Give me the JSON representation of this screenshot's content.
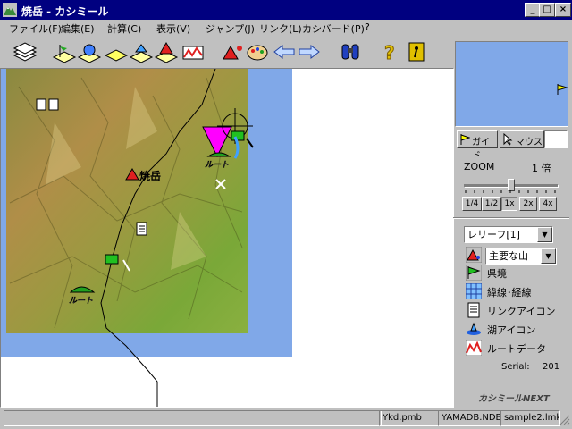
{
  "window": {
    "title": "焼岳 - カシミール"
  },
  "menu": [
    {
      "label": "ファイル(F)"
    },
    {
      "label": "編集(E)"
    },
    {
      "label": "計算(C)"
    },
    {
      "label": "表示(V)"
    },
    {
      "label": "ジャンプ(J)"
    },
    {
      "label": "リンク(L)"
    },
    {
      "label": "カシバード(P)"
    },
    {
      "label": "?"
    }
  ],
  "map": {
    "peak_label": "焼岳",
    "route_label_1": "ルート",
    "route_label_2": "ルート"
  },
  "side": {
    "tab_guide": "ガイド",
    "tab_mouse": "マウス",
    "zoom_label": "ZOOM",
    "zoom_value": "1 倍",
    "zoom_fraction": 0.5,
    "zoom_buttons": [
      "1/4",
      "1/2",
      "1x",
      "2x",
      "4x"
    ],
    "relief_select": "レリーフ[1]",
    "mountain_select": "主要な山",
    "layers": [
      {
        "label": "県境",
        "icon": "border-flag-icon"
      },
      {
        "label": "緯線･経線",
        "icon": "grid-icon"
      },
      {
        "label": "リンクアイコン",
        "icon": "document-icon"
      },
      {
        "label": "湖アイコン",
        "icon": "lake-icon"
      },
      {
        "label": "ルートデータ",
        "icon": "route-icon"
      }
    ],
    "serial_label": "Serial:",
    "serial_value": "201",
    "logo_text": "カシミールNEXT"
  },
  "status": {
    "p1": "Ykd.pmb",
    "p2": "YAMADB.NDB",
    "p3": "sample2.lmk"
  },
  "colors": {
    "titlebar": "#000080",
    "sea": "#80a8e8",
    "overview": "#80a8e8",
    "peak_marker": "#ff00ff"
  }
}
